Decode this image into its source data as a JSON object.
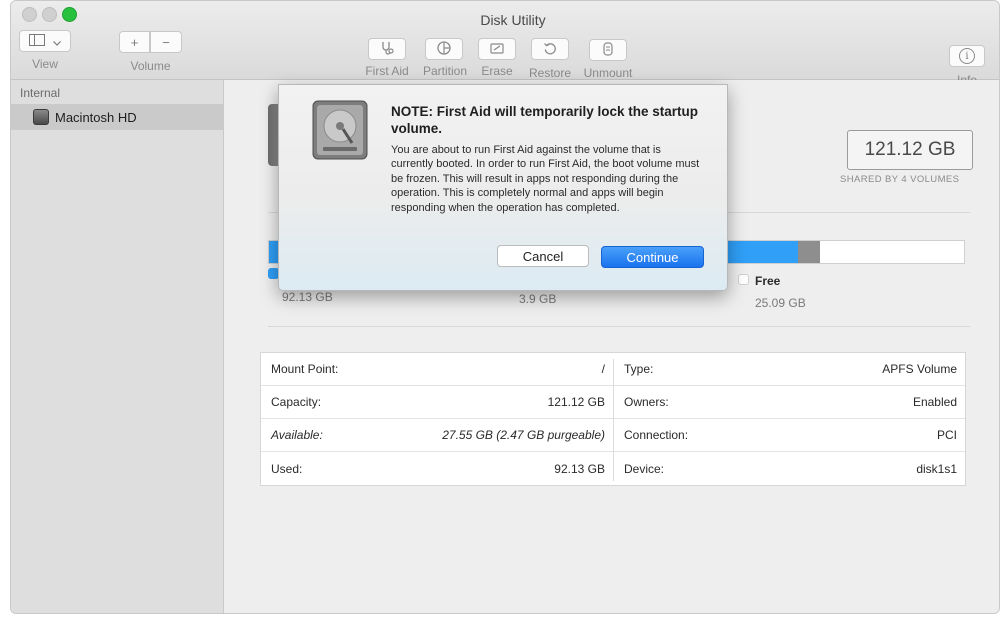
{
  "window": {
    "title": "Disk Utility"
  },
  "toolbar": {
    "view_label": "View",
    "volume_label": "Volume",
    "add_glyph": "+",
    "remove_glyph": "−",
    "first_aid_label": "First Aid",
    "partition_label": "Partition",
    "erase_label": "Erase",
    "restore_label": "Restore",
    "unmount_label": "Unmount",
    "info_label": "Info",
    "info_glyph": "i"
  },
  "sidebar": {
    "header": "Internal",
    "items": [
      {
        "label": "Macintosh HD",
        "icon": "hard-drive-icon",
        "selected": true
      }
    ]
  },
  "volume": {
    "capacity": "121.12 GB",
    "shared": "SHARED BY 4 VOLUMES"
  },
  "usage_bar": {
    "used_fraction": 0.761,
    "other_fraction": 0.032,
    "free_fraction": 0.207,
    "used_color": "#2f9ff7",
    "other_color": "#8e8e8e",
    "free_color": "#ffffff"
  },
  "legend": {
    "used_value": "92.13 GB",
    "other_value": "3.9 GB",
    "free_name": "Free",
    "free_value": "25.09 GB"
  },
  "info": {
    "left": [
      {
        "key": "Mount Point:",
        "value": "/"
      },
      {
        "key": "Capacity:",
        "value": "121.12 GB"
      },
      {
        "key": "Available:",
        "value": "27.55 GB (2.47 GB purgeable)"
      },
      {
        "key": "Used:",
        "value": "92.13 GB"
      }
    ],
    "right": [
      {
        "key": "Type:",
        "value": "APFS Volume"
      },
      {
        "key": "Owners:",
        "value": "Enabled"
      },
      {
        "key": "Connection:",
        "value": "PCI"
      },
      {
        "key": "Device:",
        "value": "disk1s1"
      }
    ]
  },
  "dialog": {
    "title": "NOTE: First Aid will temporarily lock the startup volume.",
    "body": "You are about to run First Aid against the volume that is currently booted. In order to run First Aid, the boot volume must be frozen. This will result in apps not responding during the operation. This is completely normal and apps will begin responding when the operation has completed.",
    "cancel_label": "Cancel",
    "continue_label": "Continue",
    "icon": "hard-drive-icon"
  }
}
